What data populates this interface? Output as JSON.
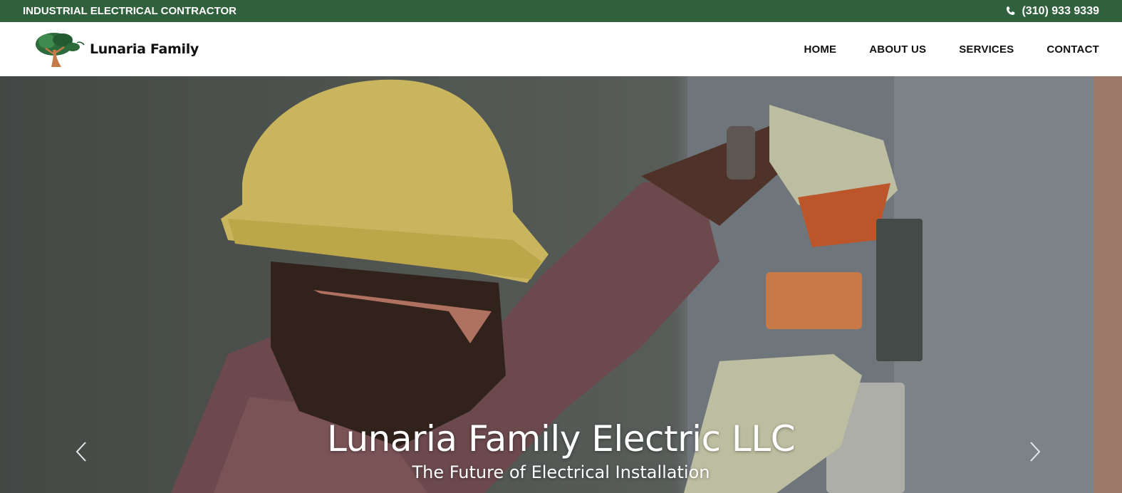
{
  "topbar": {
    "tagline": "INDUSTRIAL ELECTRICAL CONTRACTOR",
    "phone": "(310) 933 9339",
    "phone_icon": "phone-icon",
    "background": "#30603c"
  },
  "header": {
    "brand": "Lunaria Family",
    "logo_icon": "tree-logo",
    "nav": [
      {
        "label": "HOME"
      },
      {
        "label": "ABOUT US"
      },
      {
        "label": "SERVICES"
      },
      {
        "label": "CONTACT"
      }
    ]
  },
  "hero": {
    "title": "Lunaria Family Electric LLC",
    "subtitle": "The Future of Electrical Installation",
    "prev_icon": "chevron-left-icon",
    "next_icon": "chevron-right-icon"
  }
}
